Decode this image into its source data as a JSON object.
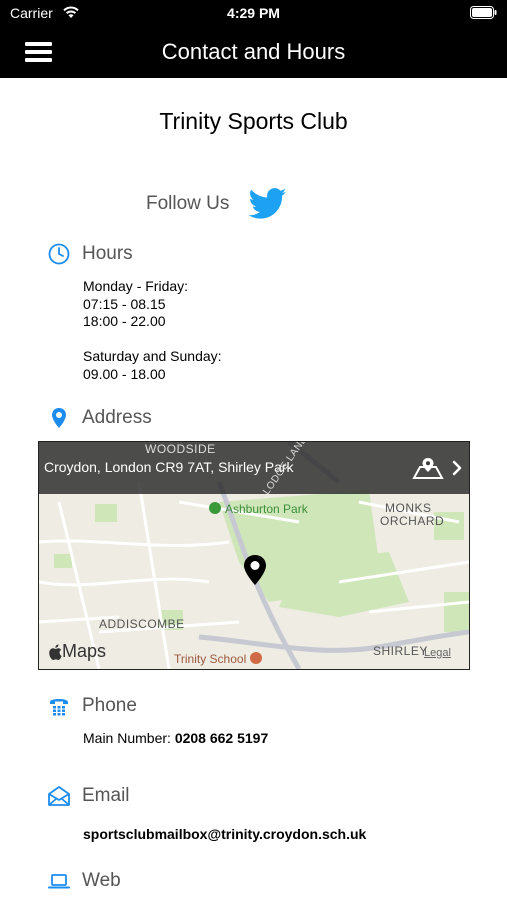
{
  "status_bar": {
    "carrier": "Carrier",
    "time": "4:29 PM"
  },
  "nav": {
    "title": "Contact and Hours"
  },
  "club": {
    "name": "Trinity Sports Club"
  },
  "follow": {
    "label": "Follow Us"
  },
  "hours": {
    "label": "Hours",
    "weekday_title": "Monday - Friday:",
    "weekday_slot1": "07:15 - 08.15",
    "weekday_slot2": "18:00 - 22.00",
    "weekend_title": "Saturday and Sunday:",
    "weekend_slot": "09.00 - 18.00"
  },
  "address": {
    "label": "Address",
    "map_address": "Croydon, London CR9 7AT, Shirley Park",
    "map_labels": {
      "woodside": "WOODSIDE",
      "lodge_lane": "LODGE LANE",
      "ashburton_park": "Ashburton Park",
      "monks": "MONKS",
      "orchard": "ORCHARD",
      "addiscombe": "ADDISCOMBE",
      "trinity_school": "Trinity School",
      "shirley": "SHIRLEY",
      "legal": "Legal",
      "maps": "Maps"
    }
  },
  "phone": {
    "label": "Phone",
    "prefix": "Main Number:",
    "number": "0208 662 5197"
  },
  "email": {
    "label": "Email",
    "address": "sportsclubmailbox@trinity.croydon.sch.uk"
  },
  "web": {
    "label": "Web"
  },
  "colors": {
    "accent": "#1d8cf0",
    "twitter": "#1da1f2",
    "bar": "#000000"
  }
}
